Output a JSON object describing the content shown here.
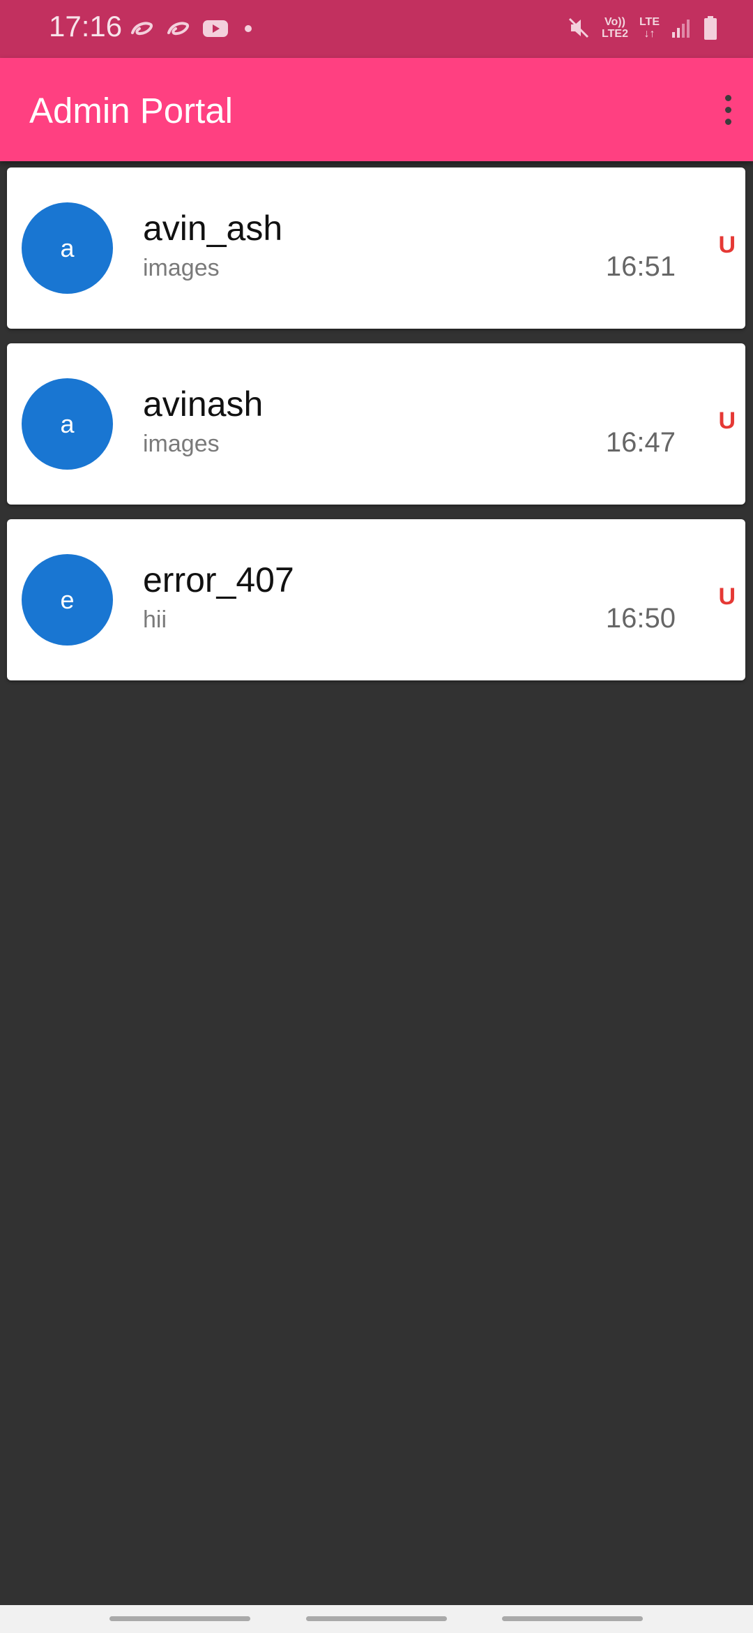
{
  "status_bar": {
    "time": "17:16",
    "left_icons": [
      "airtel-icon",
      "airtel-icon",
      "youtube-icon",
      "dot-icon"
    ],
    "network_top": "Vo))",
    "network_bottom": "LTE2",
    "lte_top": "LTE",
    "lte_bottom": "↓↑"
  },
  "app_bar": {
    "title": "Admin Portal",
    "background": "#ff4081",
    "menu_icon": "more-vert-icon"
  },
  "chats": [
    {
      "initial": "a",
      "name": "avin_ash",
      "preview": "images",
      "time": "16:51",
      "badge": "U"
    },
    {
      "initial": "a",
      "name": "avinash",
      "preview": "images",
      "time": "16:47",
      "badge": "U"
    },
    {
      "initial": "e",
      "name": "error_407",
      "preview": "hii",
      "time": "16:50",
      "badge": "U"
    }
  ],
  "colors": {
    "status_bar": "#c2305f",
    "avatar": "#1976d2",
    "badge": "#e53935",
    "background": "#323232"
  }
}
